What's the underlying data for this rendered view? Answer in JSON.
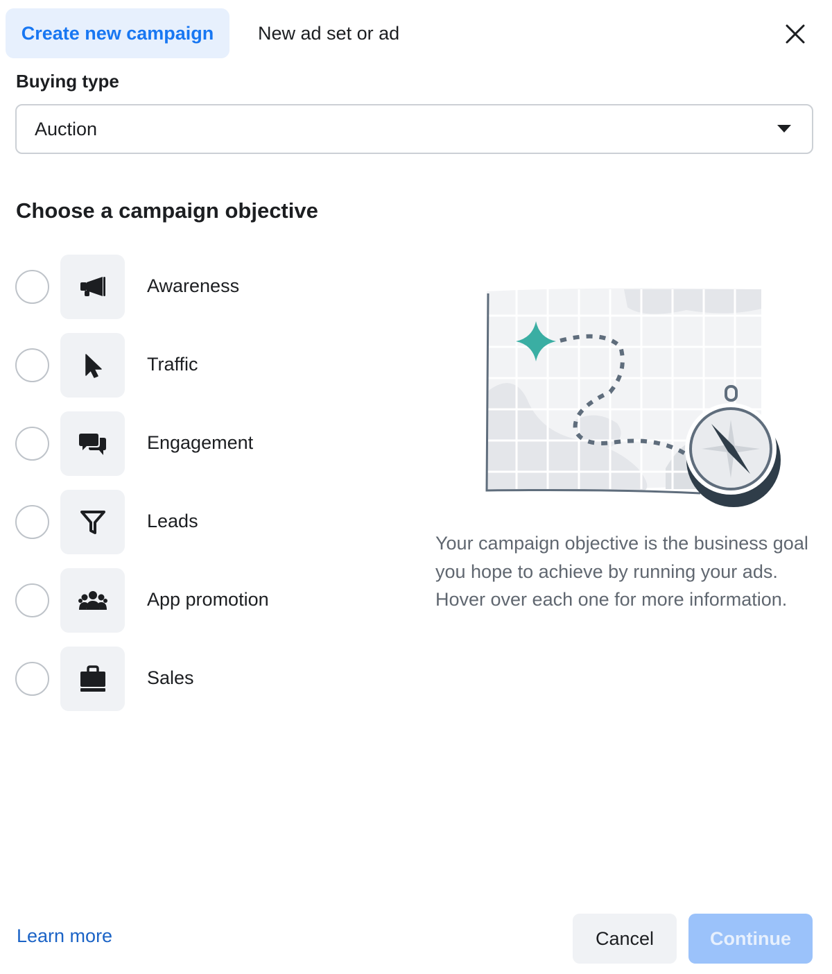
{
  "tabs": {
    "create_campaign": "Create new campaign",
    "new_ad_set_or_ad": "New ad set or ad"
  },
  "buying_type": {
    "label": "Buying type",
    "selected": "Auction"
  },
  "objective_section": {
    "title": "Choose a campaign objective",
    "options": [
      {
        "label": "Awareness",
        "icon": "megaphone-icon"
      },
      {
        "label": "Traffic",
        "icon": "cursor-icon"
      },
      {
        "label": "Engagement",
        "icon": "chat-bubbles-icon"
      },
      {
        "label": "Leads",
        "icon": "funnel-icon"
      },
      {
        "label": "App promotion",
        "icon": "people-group-icon"
      },
      {
        "label": "Sales",
        "icon": "shopping-bag-icon"
      }
    ],
    "description": "Your campaign objective is the business goal you hope to achieve by running your ads. Hover over each one for more information."
  },
  "footer": {
    "learn_more": "Learn more",
    "cancel": "Cancel",
    "continue": "Continue"
  },
  "colors": {
    "accent": "#1877f2",
    "tab_active_bg": "#e7f0fd",
    "continue_disabled": "#9bc2fa",
    "star_teal": "#3aaea3"
  }
}
